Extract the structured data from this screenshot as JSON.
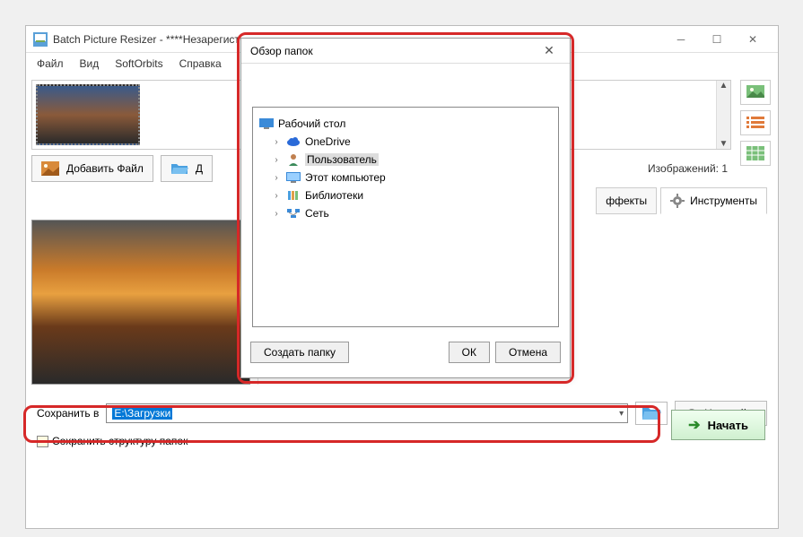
{
  "window": {
    "title": "Batch Picture Resizer - ****Незарегист"
  },
  "menu": {
    "file": "Файл",
    "view": "Вид",
    "softorbits": "SoftOrbits",
    "help": "Справка"
  },
  "toolbar": {
    "add_file": "Добавить Файл",
    "add_partial": "Д",
    "image_count": "Изображений: 1"
  },
  "tabs": {
    "effects": "ффекты",
    "tools": "Инструменты"
  },
  "save": {
    "label": "Сохранить в",
    "path": "E:\\Загрузки",
    "keep_structure": "Сохранить структуру папок",
    "settings": "Настройки"
  },
  "start": {
    "label": "Начать"
  },
  "dialog": {
    "title": "Обзор папок",
    "tree": {
      "root": "Рабочий стол",
      "items": [
        {
          "label": "OneDrive",
          "icon": "cloud"
        },
        {
          "label": "Пользователь",
          "icon": "user",
          "selected": true
        },
        {
          "label": "Этот компьютер",
          "icon": "monitor"
        },
        {
          "label": "Библиотеки",
          "icon": "library"
        },
        {
          "label": "Сеть",
          "icon": "network"
        }
      ]
    },
    "buttons": {
      "create_folder": "Создать папку",
      "ok": "ОК",
      "cancel": "Отмена"
    }
  }
}
